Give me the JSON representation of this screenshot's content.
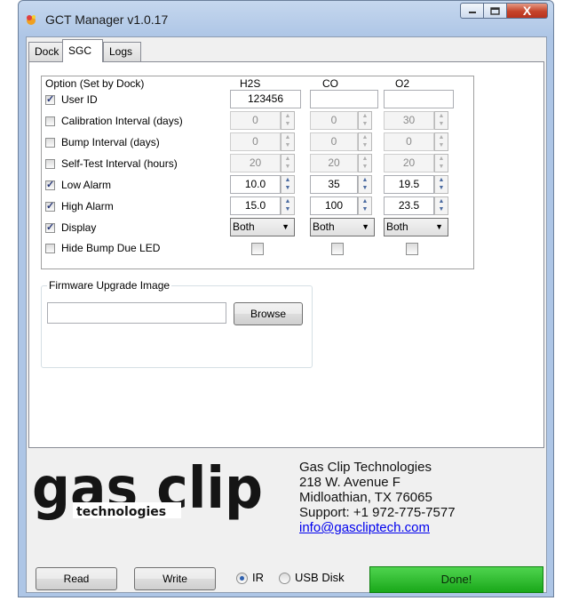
{
  "window": {
    "title": "GCT Manager v1.0.17",
    "close_glyph": "X"
  },
  "tabs": [
    {
      "label": "Dock"
    },
    {
      "label": "SGC"
    },
    {
      "label": "Logs"
    }
  ],
  "options": {
    "title": "Option (Set by Dock)",
    "columns": [
      "H2S",
      "CO",
      "O2"
    ],
    "rows": [
      {
        "label": "User ID",
        "checked": true
      },
      {
        "label": "Calibration Interval (days)",
        "checked": false
      },
      {
        "label": "Bump Interval (days)",
        "checked": false
      },
      {
        "label": "Self-Test Interval (hours)",
        "checked": false
      },
      {
        "label": "Low Alarm",
        "checked": true
      },
      {
        "label": "High Alarm",
        "checked": true
      },
      {
        "label": "Display",
        "checked": true
      },
      {
        "label": "Hide Bump Due LED",
        "checked": false
      }
    ],
    "user_id": [
      "123456",
      "",
      ""
    ],
    "cal_interval": [
      "0",
      "0",
      "30"
    ],
    "bump_interval": [
      "0",
      "0",
      "0"
    ],
    "selftest_interval": [
      "20",
      "20",
      "20"
    ],
    "low_alarm": [
      "10.0",
      "35",
      "19.5"
    ],
    "high_alarm": [
      "15.0",
      "100",
      "23.5"
    ],
    "display": [
      "Both",
      "Both",
      "Both"
    ]
  },
  "firmware": {
    "label": "Firmware Upgrade Image",
    "path": "",
    "browse": "Browse"
  },
  "logo": {
    "text_main": "gas clip",
    "text_sub": "technologies"
  },
  "contact": {
    "company": "Gas Clip Technologies",
    "address1": "218 W. Avenue F",
    "address2": "Midloathian, TX 76065",
    "support": "Support:  +1  972-775-7577",
    "email": "info@gascliptech.com"
  },
  "bottom": {
    "read": "Read",
    "write": "Write",
    "ir": "IR",
    "usb": "USB Disk",
    "selected": "IR",
    "status": "Done!",
    "status_color": "#22b522"
  }
}
